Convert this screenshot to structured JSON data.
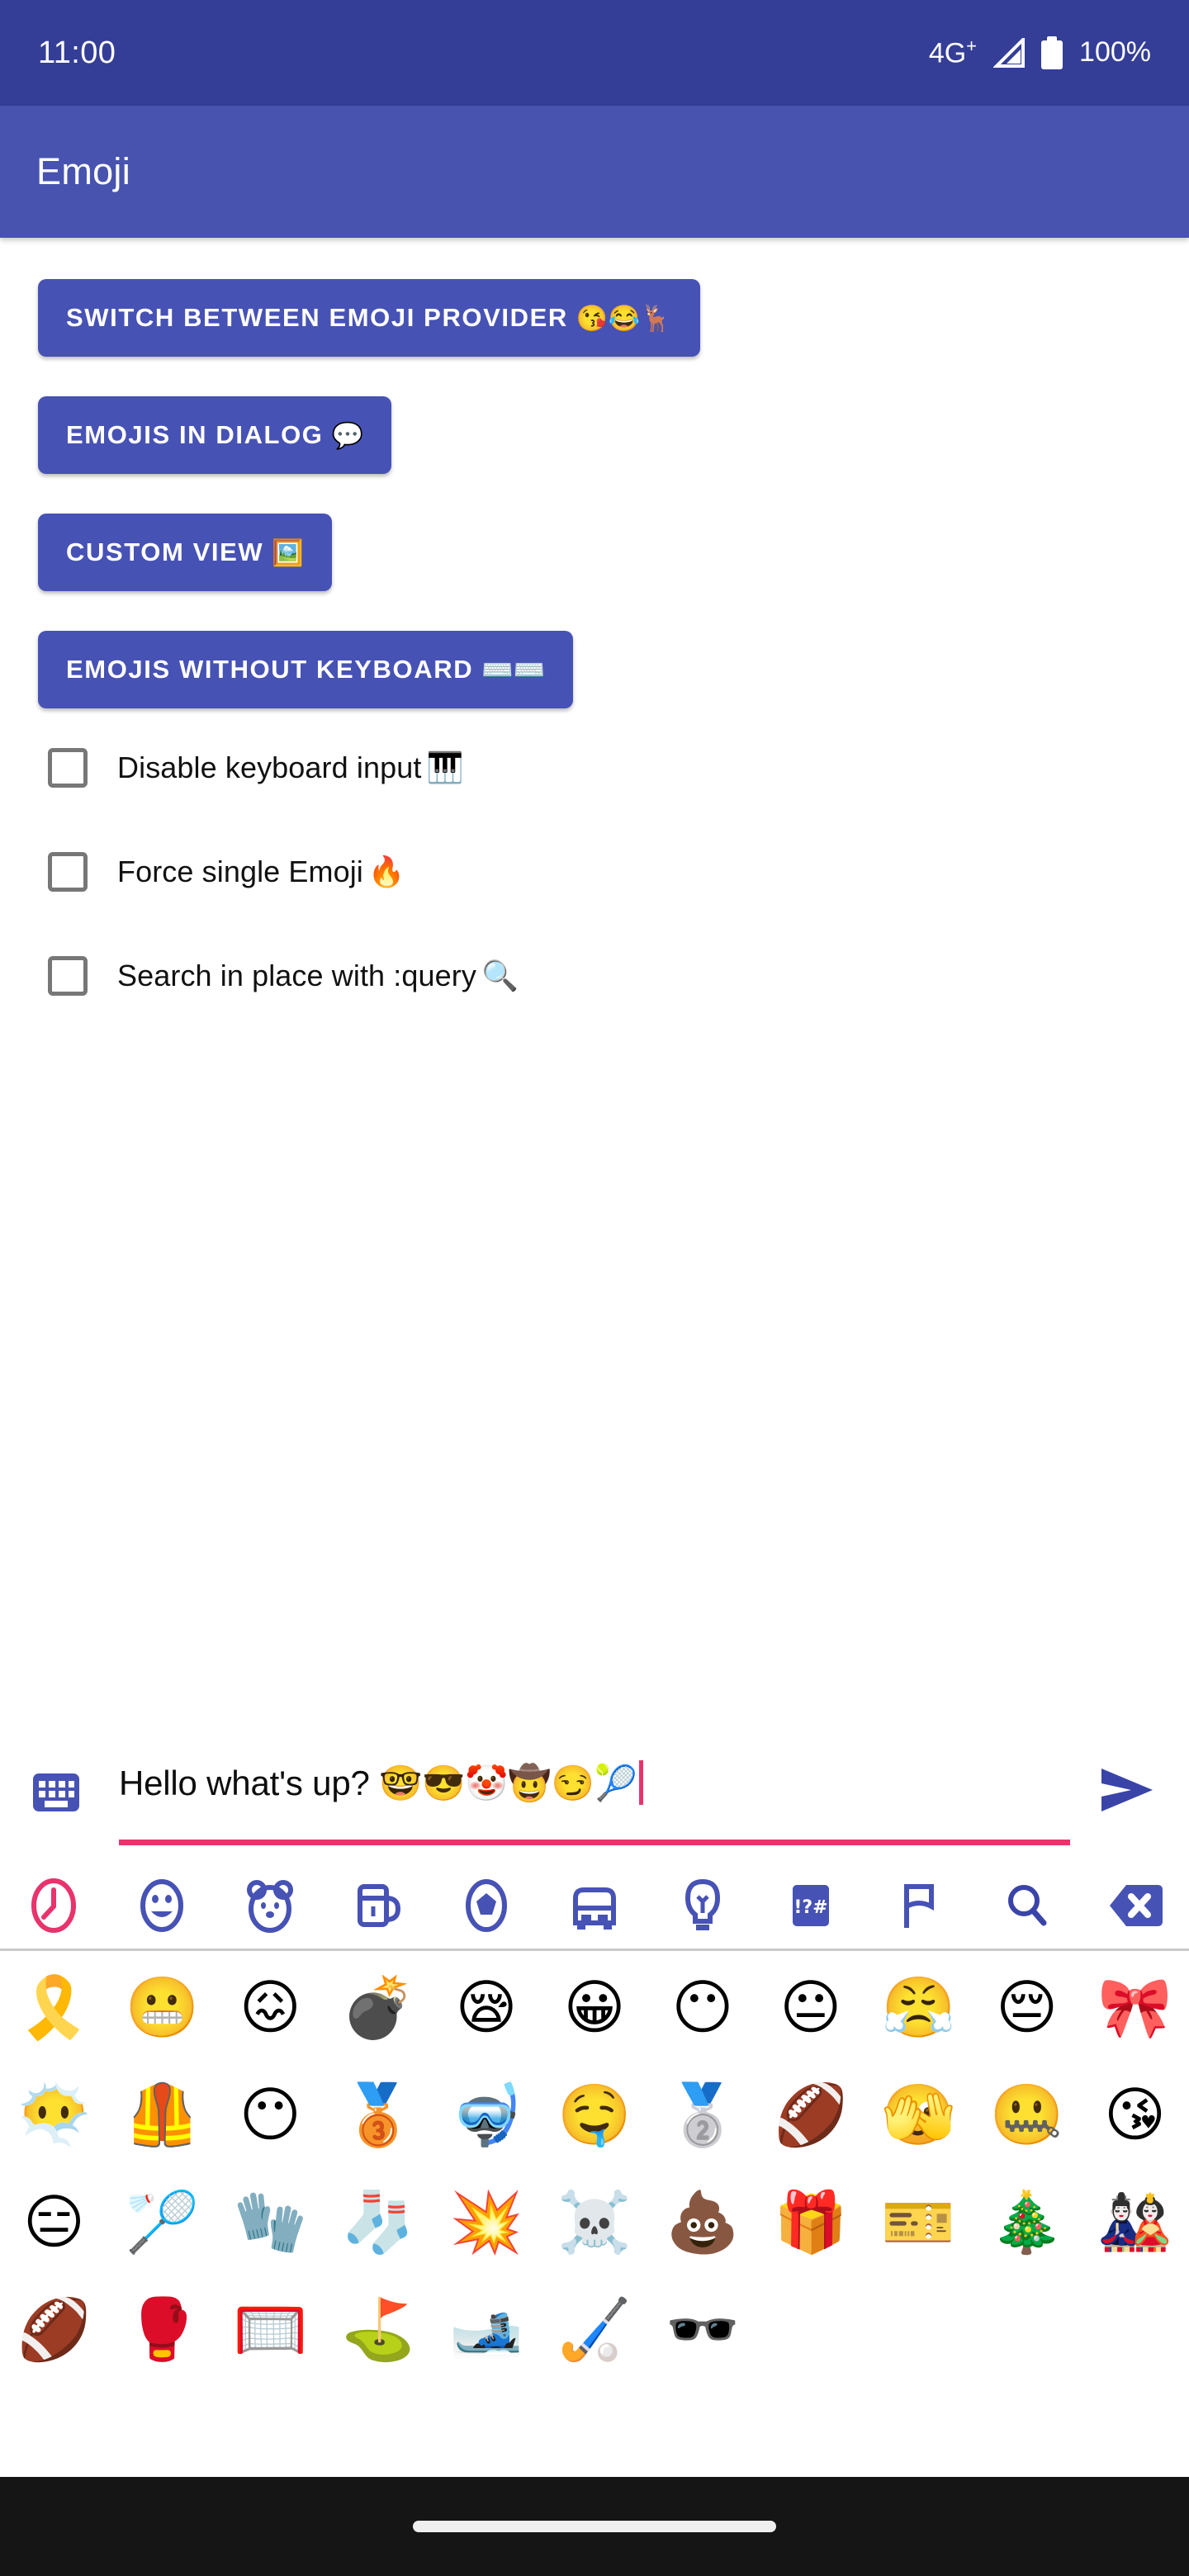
{
  "status_bar": {
    "time": "11:00",
    "network": "4G",
    "network_sup": "+",
    "battery": "100%",
    "signal_icon": "signal-triangle-icon",
    "battery_icon": "battery-full-icon",
    "background_color": "#343e96"
  },
  "app_bar": {
    "title": "Emoji",
    "background_color": "#4753ae"
  },
  "buttons": [
    {
      "label": "SWITCH BETWEEN EMOJI PROVIDER",
      "emoji": "😘😂🦌",
      "name": "switch-between-emoji-provider-button"
    },
    {
      "label": "EMOJIS IN DIALOG",
      "emoji": "💬",
      "name": "emojis-in-dialog-button"
    },
    {
      "label": "CUSTOM VIEW",
      "emoji": "🖼️",
      "name": "custom-view-button"
    },
    {
      "label": "EMOJIS WITHOUT KEYBOARD",
      "emoji": "⌨️⌨️",
      "name": "emojis-without-keyboard-button"
    }
  ],
  "checkboxes": [
    {
      "label": "Disable keyboard input",
      "emoji": "🎹",
      "checked": false,
      "name": "disable-keyboard-input-checkbox"
    },
    {
      "label": "Force single Emoji",
      "emoji": "🔥",
      "checked": false,
      "name": "force-single-emoji-checkbox"
    },
    {
      "label": "Search in place with :query",
      "emoji": "🔍",
      "checked": false,
      "name": "search-in-place-checkbox"
    }
  ],
  "input": {
    "text": "Hello what's up? 🤓😎🤡🤠😏🎾",
    "placeholder": "",
    "underline_color": "#e8336d",
    "caret_color": "#e8336d",
    "keyboard_icon": "keyboard-icon",
    "send_icon": "send-icon",
    "accent_color": "#4752b5"
  },
  "emoji_tabs": [
    {
      "name": "tab-recent",
      "icon": "clock-icon",
      "selected": true
    },
    {
      "name": "tab-smileys",
      "icon": "smiley-icon",
      "selected": false
    },
    {
      "name": "tab-animals",
      "icon": "bear-icon",
      "selected": false
    },
    {
      "name": "tab-food",
      "icon": "cup-icon",
      "selected": false
    },
    {
      "name": "tab-sports",
      "icon": "soccer-ball-icon",
      "selected": false
    },
    {
      "name": "tab-travel",
      "icon": "car-icon",
      "selected": false
    },
    {
      "name": "tab-objects",
      "icon": "lightbulb-icon",
      "selected": false
    },
    {
      "name": "tab-symbols",
      "icon": "symbols-icon",
      "selected": false
    },
    {
      "name": "tab-flags",
      "icon": "flag-icon",
      "selected": false
    },
    {
      "name": "tab-search",
      "icon": "search-icon",
      "selected": false
    },
    {
      "name": "tab-backspace",
      "icon": "backspace-icon",
      "selected": false
    }
  ],
  "emoji_tab_colors": {
    "selected": "#e8336d",
    "default": "#4752b5"
  },
  "emoji_grid": {
    "rows": [
      [
        "🎗️",
        "😬",
        "😖",
        "💣",
        "😪",
        "😀",
        "😶",
        "😐",
        "😤",
        "😔",
        "🎀"
      ],
      [
        "😶‍🌫️",
        "🦺",
        "😶",
        "🥉",
        "🤿",
        "🤤",
        "🥈",
        "🏈",
        "🫣",
        "🤐",
        "😘"
      ],
      [
        "😑",
        "🏸",
        "🧤",
        "🧦",
        "💥",
        "☠️",
        "💩",
        "🎁",
        "🎫",
        "🎄",
        "🎎"
      ],
      [
        "🏈",
        "🥊",
        "🥅",
        "⛳",
        "🎿",
        "🏑",
        "🕶️"
      ]
    ]
  },
  "collapse": {
    "icon": "chevron-down-icon"
  },
  "nav_bar": {
    "icon": "home-pill-indicator"
  }
}
